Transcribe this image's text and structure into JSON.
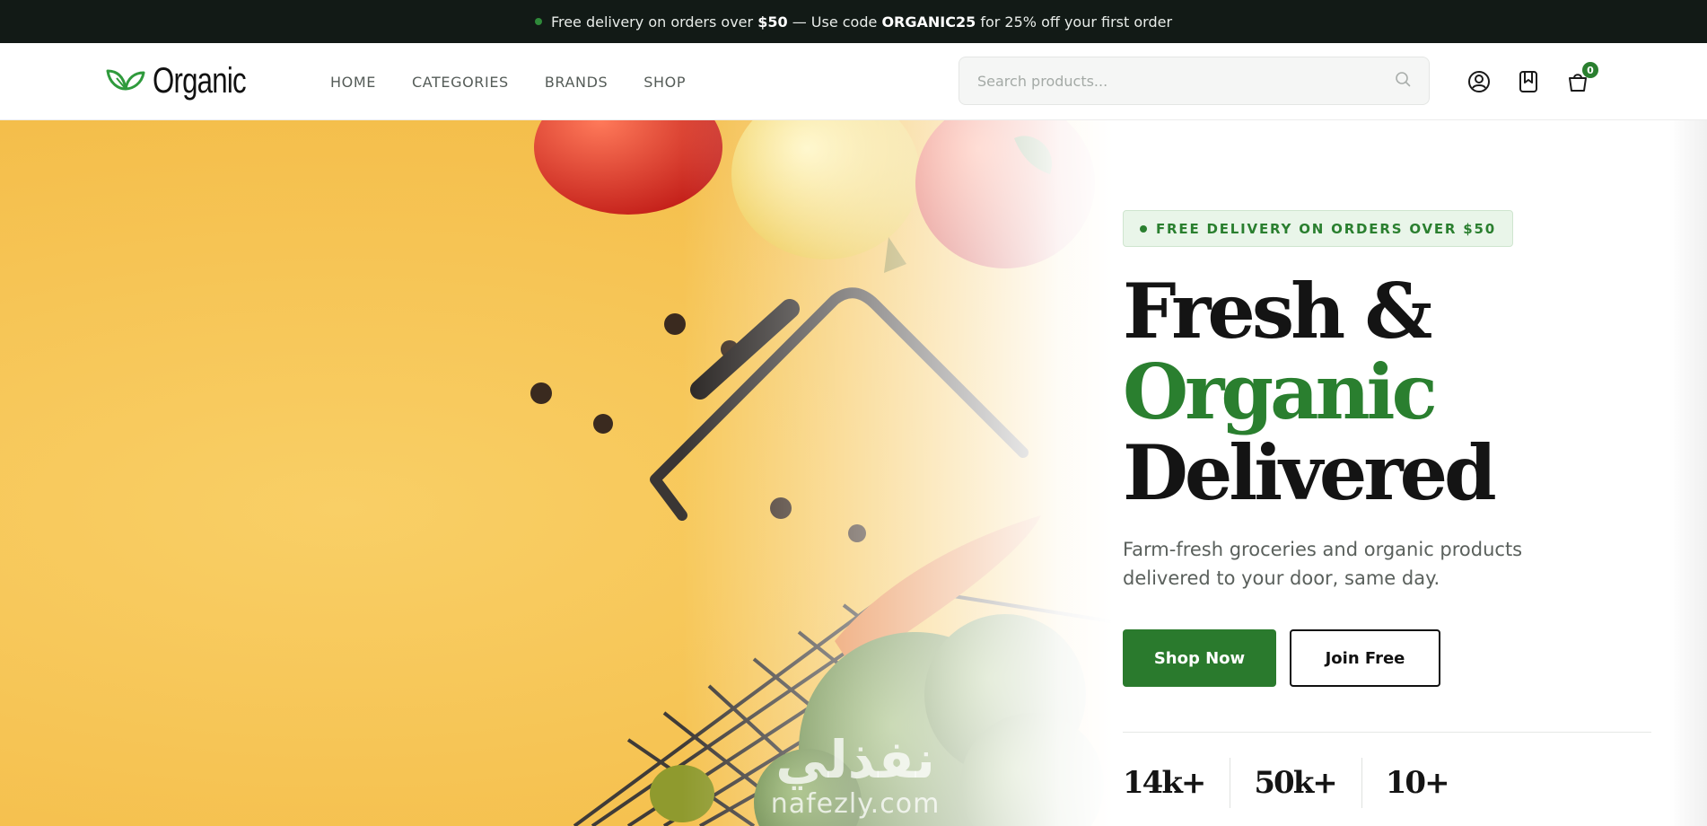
{
  "topbar": {
    "prefix": "Free delivery on orders over",
    "amount": "$50",
    "middle": "— Use code",
    "code": "ORGANIC25",
    "suffix": "for 25% off your first order"
  },
  "header": {
    "logo_text": "Organic",
    "nav": [
      "HOME",
      "CATEGORIES",
      "BRANDS",
      "SHOP"
    ],
    "search_placeholder": "Search products...",
    "cart_count": "0"
  },
  "hero": {
    "pill": "FREE DELIVERY ON ORDERS OVER $50",
    "headline_line1": "Fresh &",
    "headline_line2": "Organic",
    "headline_line3": "Delivered",
    "subhead": "Farm-fresh groceries and organic products delivered to your door, same day.",
    "primary_cta": "Shop Now",
    "secondary_cta": "Join Free",
    "stats": [
      "14k+",
      "50k+",
      "10+"
    ]
  },
  "watermark": {
    "arabic": "نفذلي",
    "latin": "nafezly.com"
  },
  "colors": {
    "accent_green": "#2a7f2f",
    "topbar_bg": "#121a16",
    "hero_yellow": "#f6c14f"
  }
}
